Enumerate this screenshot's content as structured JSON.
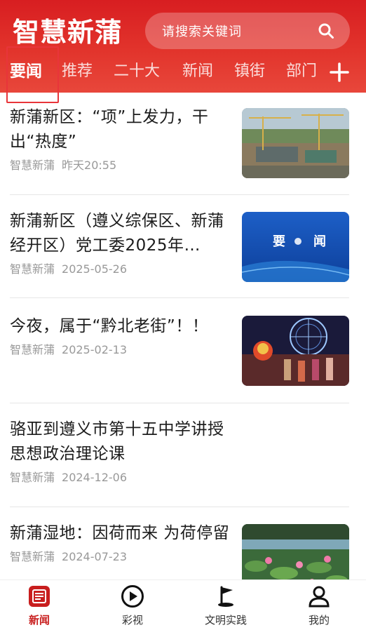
{
  "app": {
    "logo_text": "智慧新蒲",
    "search_placeholder": "请搜索关键词"
  },
  "tabs": [
    {
      "label": "要闻",
      "active": true
    },
    {
      "label": "推荐",
      "active": false
    },
    {
      "label": "二十大",
      "active": false
    },
    {
      "label": "新闻",
      "active": false
    },
    {
      "label": "镇街",
      "active": false
    },
    {
      "label": "部门",
      "active": false
    }
  ],
  "feed": [
    {
      "title": "新蒲新区：“项”上发力，干出“热度”",
      "source": "智慧新蒲",
      "date": "昨天20:55",
      "thumbnail": "construction-site-photo"
    },
    {
      "title": "新蒲新区（遵义综保区、新蒲经开区）党工委2025年…",
      "source": "智慧新蒲",
      "date": "2025-05-26",
      "thumbnail": "yaowen-banner",
      "thumb_text": [
        "要",
        "闻"
      ]
    },
    {
      "title": "今夜，属于“黔北老街”！！",
      "source": "智慧新蒲",
      "date": "2025-02-13",
      "thumbnail": "night-festival-photo"
    },
    {
      "title": "骆亚到遵义市第十五中学讲授思想政治理论课",
      "source": "智慧新蒲",
      "date": "2024-12-06"
    },
    {
      "title": "新蒲湿地：因荷而来 为荷停留",
      "source": "智慧新蒲",
      "date": "2024-07-23",
      "thumbnail": "lotus-wetland-photo"
    }
  ],
  "bottom_nav": [
    {
      "label": "新闻",
      "icon": "news-icon",
      "active": true
    },
    {
      "label": "彩视",
      "icon": "play-icon",
      "active": false
    },
    {
      "label": "文明实践",
      "icon": "flag-icon",
      "active": false
    },
    {
      "label": "我的",
      "icon": "user-icon",
      "active": false
    }
  ],
  "colors": {
    "brand_red": "#d81e21",
    "active_nav": "#c81e1e",
    "meta_gray": "#999999"
  }
}
